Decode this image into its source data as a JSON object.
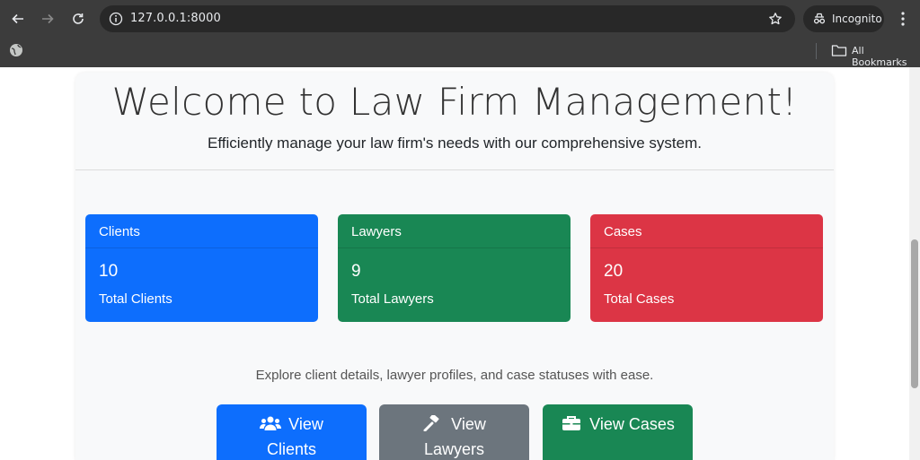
{
  "browser": {
    "url": "127.0.0.1:8000",
    "incognito_label": "Incognito",
    "bookmarks_label": "All Bookmarks"
  },
  "hero": {
    "title": "Welcome to Law Firm Management!",
    "subtitle": "Efficiently manage your law firm's needs with our comprehensive system."
  },
  "cards": [
    {
      "header": "Clients",
      "count": "10",
      "label": "Total Clients",
      "color": "#0d6efd"
    },
    {
      "header": "Lawyers",
      "count": "9",
      "label": "Total Lawyers",
      "color": "#198754"
    },
    {
      "header": "Cases",
      "count": "20",
      "label": "Total Cases",
      "color": "#dc3545"
    }
  ],
  "explore_text": "Explore client details, lawyer profiles, and case statuses with ease.",
  "actions": [
    {
      "line1": "View",
      "line2": "Clients",
      "icon": "users-icon",
      "color": "#0d6efd"
    },
    {
      "line1": "View",
      "line2": "Lawyers",
      "icon": "gavel-icon",
      "color": "#6c757d"
    },
    {
      "line1": "View Cases",
      "line2": "",
      "icon": "briefcase-icon",
      "color": "#198754"
    }
  ]
}
